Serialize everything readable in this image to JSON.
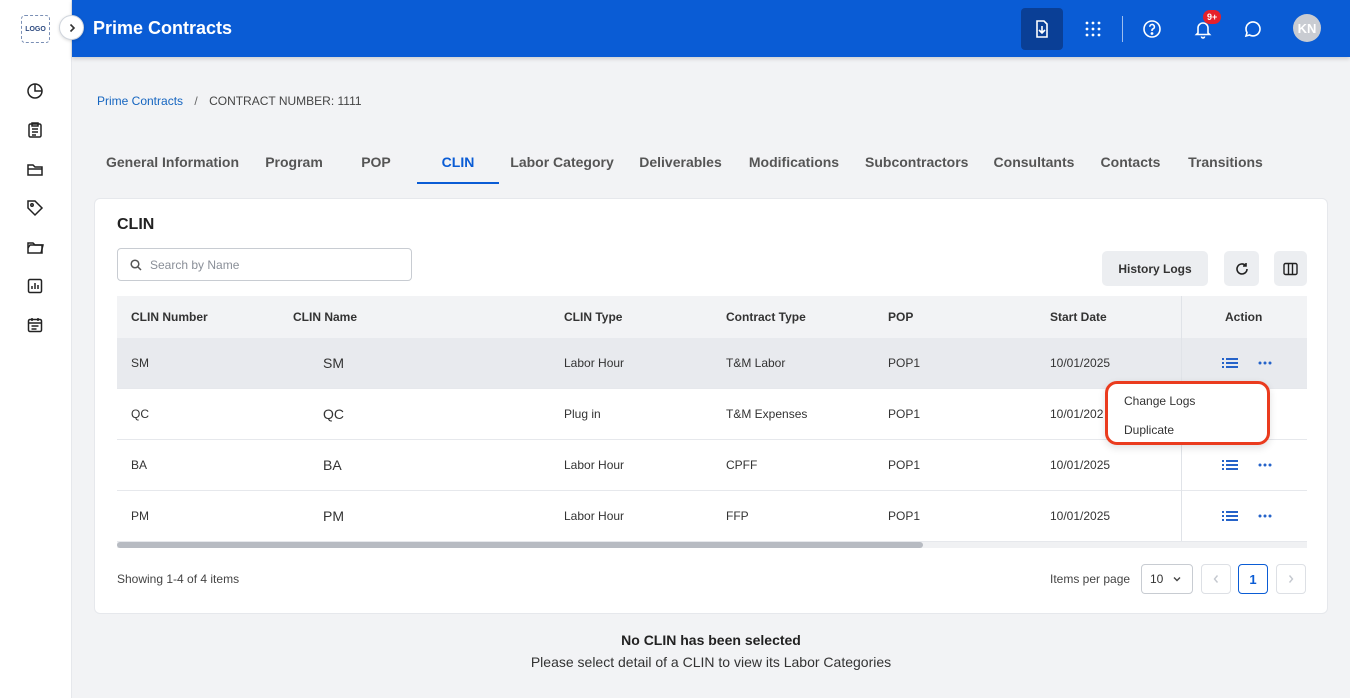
{
  "app": {
    "logo_text": "LOGO",
    "title": "Prime Contracts",
    "notifications_badge": "9+",
    "avatar_initials": "KN",
    "accent_color": "#0a5cd5"
  },
  "sidebar": {
    "icons": [
      "dashboard-icon",
      "clipboard-icon",
      "folder-icon",
      "tags-icon",
      "folder-open-icon",
      "report-icon",
      "calendar-icon"
    ]
  },
  "breadcrumb": {
    "parent": "Prime Contracts",
    "separator": "/",
    "current": "CONTRACT NUMBER: 1111"
  },
  "tabs": [
    {
      "label": "General Information"
    },
    {
      "label": "Program"
    },
    {
      "label": "POP"
    },
    {
      "label": "CLIN",
      "active": true
    },
    {
      "label": "Labor Category"
    },
    {
      "label": "Deliverables"
    },
    {
      "label": "Modifications"
    },
    {
      "label": "Subcontractors"
    },
    {
      "label": "Consultants"
    },
    {
      "label": "Contacts"
    },
    {
      "label": "Transitions"
    }
  ],
  "clin": {
    "title": "CLIN",
    "search_placeholder": "Search by Name",
    "history_logs_label": "History Logs",
    "columns": [
      "CLIN Number",
      "CLIN Name",
      "CLIN Type",
      "Contract Type",
      "POP",
      "Start Date",
      "Action"
    ],
    "rows": [
      {
        "number": "SM",
        "name": "SM",
        "type": "Labor Hour",
        "contract_type": "T&M Labor",
        "pop": "POP1",
        "start_date": "10/01/2025"
      },
      {
        "number": "QC",
        "name": "QC",
        "type": "Plug in",
        "contract_type": "T&M Expenses",
        "pop": "POP1",
        "start_date": "10/01/202"
      },
      {
        "number": "BA",
        "name": "BA",
        "type": "Labor Hour",
        "contract_type": "CPFF",
        "pop": "POP1",
        "start_date": "10/01/2025"
      },
      {
        "number": "PM",
        "name": "PM",
        "type": "Labor Hour",
        "contract_type": "FFP",
        "pop": "POP1",
        "start_date": "10/01/2025"
      }
    ],
    "action_menu": [
      "Change Logs",
      "Duplicate"
    ],
    "footer": {
      "showing": "Showing 1-4 of 4 items",
      "items_per_page_label": "Items per page",
      "items_per_page_value": "10",
      "current_page": "1"
    }
  },
  "empty_state": {
    "title": "No CLIN has been selected",
    "subtitle": "Please select detail of a CLIN to view its Labor Categories"
  }
}
